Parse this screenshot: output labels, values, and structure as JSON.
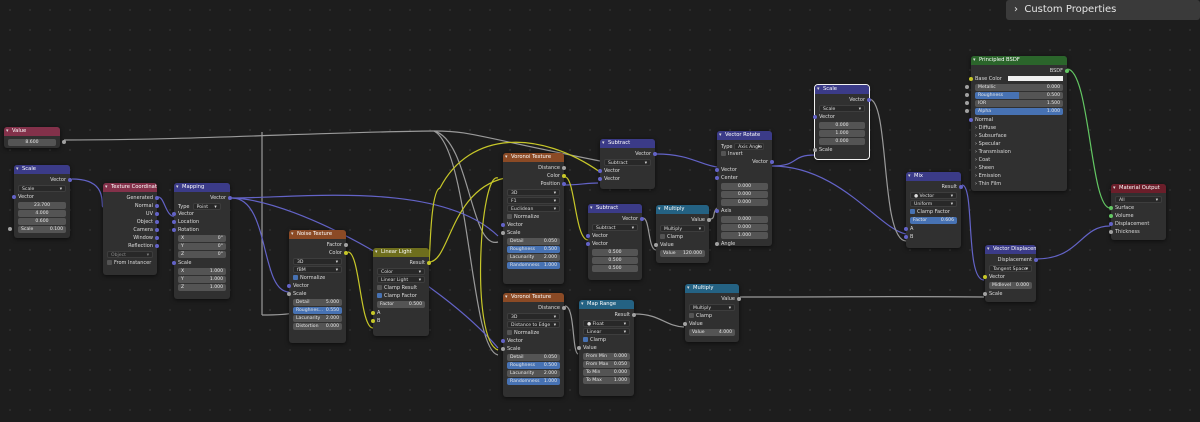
{
  "panel": {
    "custom_properties": "Custom Properties",
    "chevron": "chevron-right-icon"
  },
  "colors": {
    "input": "#83314a",
    "vector": "#3b3b88",
    "texture": "#8b4a25",
    "color": "#6e6e1d",
    "converter": "#246283",
    "shader": "#2b652b",
    "output": "#6b1e2a"
  },
  "nodes": {
    "value": {
      "title": "Value",
      "out": "Value",
      "val": "8.600"
    },
    "scale1": {
      "title": "Scale",
      "out": "Vector",
      "mode": "Scale",
      "in": "Vector",
      "v": [
        "23.700",
        "4.000",
        "0.600"
      ],
      "scale_label": "Scale",
      "scale_val": "0.100"
    },
    "texcoord": {
      "title": "Texture Coordinate",
      "outs": [
        "Generated",
        "Normal",
        "UV",
        "Object",
        "Camera",
        "Window",
        "Reflection"
      ],
      "object": "Object",
      "instancer": "From Instancer"
    },
    "mapping": {
      "title": "Mapping",
      "out": "Vector",
      "type_label": "Type",
      "type": "Point",
      "in": "Vector",
      "location": "Location",
      "rotation": "Rotation",
      "rot": [
        [
          "X",
          "0°"
        ],
        [
          "Y",
          "0°"
        ],
        [
          "Z",
          "0°"
        ]
      ],
      "scale": "Scale",
      "scl": [
        [
          "X",
          "1.000"
        ],
        [
          "Y",
          "1.000"
        ],
        [
          "Z",
          "1.000"
        ]
      ]
    },
    "noise": {
      "title": "Noise Texture",
      "outs": [
        "Factor",
        "Color"
      ],
      "dim": "3D",
      "type": "fBM",
      "normalize": "Normalize",
      "in": "Vector",
      "scale": "Scale",
      "detail": [
        "Detail",
        "5.000"
      ],
      "rough": [
        "Roughnes...",
        "0.550"
      ],
      "lac": [
        "Lacunarity",
        "2.000"
      ],
      "dist": [
        "Distortion",
        "0.000"
      ]
    },
    "linear": {
      "title": "Linear Light",
      "out": "Result",
      "type": "Color",
      "mode": "Linear Light",
      "clamp_result": "Clamp Result",
      "clamp_factor": "Clamp Factor",
      "factor": [
        "Factor",
        "0.500"
      ],
      "a": "A",
      "b": "B"
    },
    "voronoi1": {
      "title": "Voronoi Texture",
      "outs": [
        "Distance",
        "Color",
        "Position"
      ],
      "dim": "3D",
      "feat": "F1",
      "metric": "Euclidean",
      "normalize": "Normalize",
      "in": "Vector",
      "scale": "Scale",
      "detail": [
        "Detail",
        "0.050"
      ],
      "rough": [
        "Roughness",
        "0.500"
      ],
      "lac": [
        "Lacunarity",
        "2.000"
      ],
      "rand": [
        "Randomness",
        "1.000"
      ]
    },
    "voronoi2": {
      "title": "Voronoi Texture",
      "out": "Distance",
      "dim": "3D",
      "feat": "Distance to Edge",
      "normalize": "Normalize",
      "in": "Vector",
      "scale": "Scale",
      "detail": [
        "Detail",
        "0.050"
      ],
      "rough": [
        "Roughness",
        "0.500"
      ],
      "lac": [
        "Lacunarity",
        "2.000"
      ],
      "rand": [
        "Randomness",
        "1.000"
      ]
    },
    "subtract1": {
      "title": "Subtract",
      "out": "Vector",
      "mode": "Subtract",
      "ins": [
        "Vector",
        "Vector"
      ]
    },
    "subtract2": {
      "title": "Subtract",
      "out": "Vector",
      "mode": "Subtract",
      "ins": [
        "Vector",
        "Vector"
      ],
      "v": [
        "0.500",
        "0.500",
        "0.500"
      ]
    },
    "multiply1": {
      "title": "Multiply",
      "out": "Value",
      "mode": "Multiply",
      "clamp": "Clamp",
      "in": "Value",
      "val": [
        "Value",
        "120.000"
      ]
    },
    "maprange": {
      "title": "Map Range",
      "out": "Result",
      "type": "Float",
      "interp": "Linear",
      "clamp": "Clamp",
      "in": "Value",
      "from_min": [
        "From Min",
        "0.000"
      ],
      "from_max": [
        "From Max",
        "0.050"
      ],
      "to_min": [
        "To Min",
        "0.000"
      ],
      "to_max": [
        "To Max",
        "1.000"
      ]
    },
    "multiply2": {
      "title": "Multiply",
      "out": "Value",
      "mode": "Multiply",
      "clamp": "Clamp",
      "in": "Value",
      "val": [
        "Value",
        "4.000"
      ]
    },
    "vrotate": {
      "title": "Vector Rotate",
      "type_label": "Type",
      "type": "Axis Angle",
      "invert": "Invert",
      "out": "Vector",
      "in": "Vector",
      "center": "Center",
      "c": [
        "0.000",
        "0.000",
        "0.000"
      ],
      "axis": "Axis",
      "ax": [
        "0.000",
        "0.000",
        "1.000"
      ],
      "angle": "Angle"
    },
    "scale2": {
      "title": "Scale",
      "out": "Vector",
      "mode": "Scale",
      "in": "Vector",
      "v": [
        "0.000",
        "1.000",
        "0.000"
      ],
      "scale": "Scale"
    },
    "mix": {
      "title": "Mix",
      "out": "Result",
      "type": "Vector",
      "mode": "Uniform",
      "clamp": "Clamp Factor",
      "factor": [
        "Factor",
        "0.606"
      ],
      "a": "A",
      "b": "B"
    },
    "vdisp": {
      "title": "Vector Displacem...",
      "out": "Displacement",
      "space": "Tangent Space",
      "in": "Vector",
      "mid": [
        "Midlevel",
        "0.000"
      ],
      "scale": "Scale"
    },
    "bsdf": {
      "title": "Principled BSDF",
      "out": "BSDF",
      "base": "Base Color",
      "metallic": [
        "Metallic",
        "0.000"
      ],
      "rough": [
        "Roughness",
        "0.500"
      ],
      "ior": [
        "IOR",
        "1.500"
      ],
      "alpha": [
        "Alpha",
        "1.000"
      ],
      "normal": "Normal",
      "panels": [
        "Diffuse",
        "Subsurface",
        "Specular",
        "Transmission",
        "Coat",
        "Sheen",
        "Emission",
        "Thin Film"
      ]
    },
    "matout": {
      "title": "Material Output",
      "target": "All",
      "ins": [
        "Surface",
        "Volume",
        "Displacement",
        "Thickness"
      ]
    }
  }
}
